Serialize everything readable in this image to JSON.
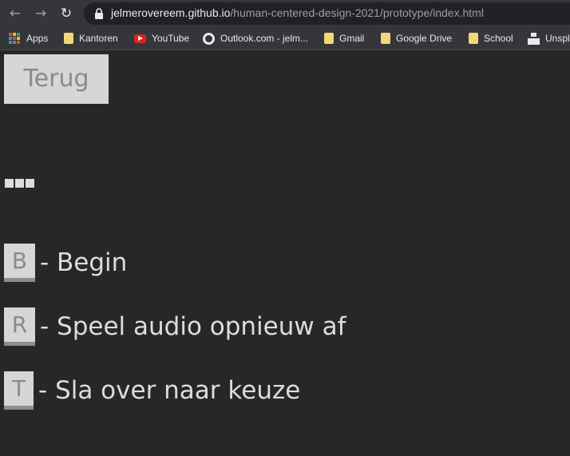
{
  "browser": {
    "url_host": "jelmerovereem.github.io",
    "url_path": "/human-centered-design-2021/prototype/index.html",
    "bookmarks": [
      {
        "label": "Apps",
        "icon": "apps-grid-icon"
      },
      {
        "label": "Kantoren",
        "icon": "folder-icon"
      },
      {
        "label": "YouTube",
        "icon": "youtube-icon"
      },
      {
        "label": "Outlook.com - jelm...",
        "icon": "globe-icon"
      },
      {
        "label": "Gmail",
        "icon": "folder-icon"
      },
      {
        "label": "Google Drive",
        "icon": "folder-icon"
      },
      {
        "label": "School",
        "icon": "folder-icon"
      },
      {
        "label": "Unspl",
        "icon": "unsplash-icon"
      }
    ]
  },
  "page": {
    "back_label": "Terug",
    "dots": "■■■",
    "shortcuts": [
      {
        "key": "B",
        "description": "- Begin"
      },
      {
        "key": "R",
        "description": "- Speel audio opnieuw af"
      },
      {
        "key": "T",
        "description": "- Sla over naar keuze"
      }
    ]
  }
}
